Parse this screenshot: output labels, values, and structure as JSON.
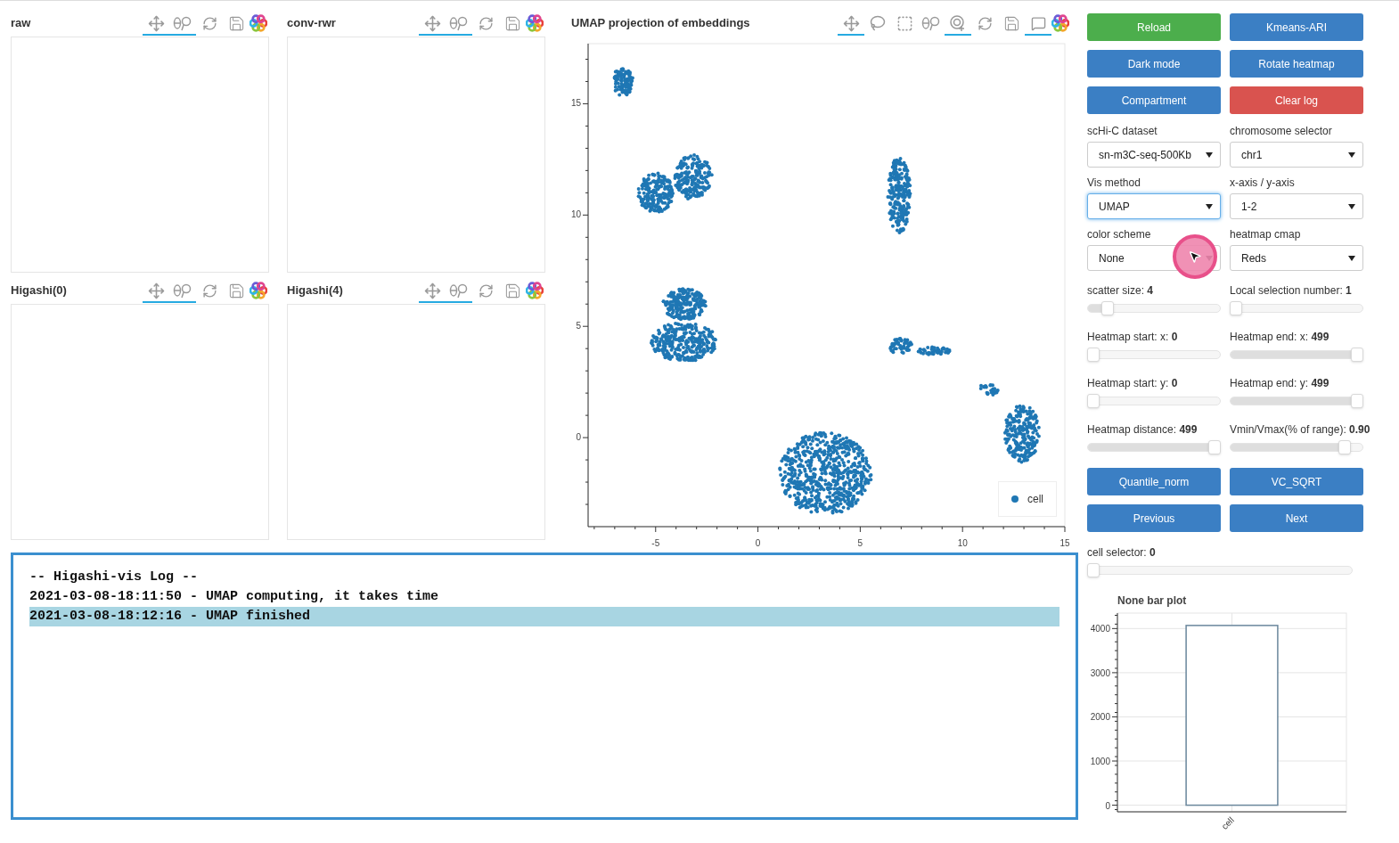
{
  "small_plots": [
    {
      "title": "raw",
      "tools": [
        {
          "kind": "pan",
          "active": true
        },
        {
          "kind": "wheel_zoom",
          "active": true
        },
        {
          "kind": "reset",
          "active": false
        },
        {
          "kind": "save",
          "active": false
        },
        {
          "kind": "logo"
        }
      ]
    },
    {
      "title": "conv-rwr",
      "tools": [
        {
          "kind": "pan",
          "active": true
        },
        {
          "kind": "wheel_zoom",
          "active": true
        },
        {
          "kind": "reset",
          "active": false
        },
        {
          "kind": "save",
          "active": false
        },
        {
          "kind": "logo"
        }
      ]
    },
    {
      "title": "Higashi(0)",
      "tools": [
        {
          "kind": "pan",
          "active": true
        },
        {
          "kind": "wheel_zoom",
          "active": true
        },
        {
          "kind": "reset",
          "active": false
        },
        {
          "kind": "save",
          "active": false
        },
        {
          "kind": "logo"
        }
      ]
    },
    {
      "title": "Higashi(4)",
      "tools": [
        {
          "kind": "pan",
          "active": true
        },
        {
          "kind": "wheel_zoom",
          "active": true
        },
        {
          "kind": "reset",
          "active": false
        },
        {
          "kind": "save",
          "active": false
        },
        {
          "kind": "logo"
        }
      ]
    }
  ],
  "scatter": {
    "title": "UMAP projection of embeddings",
    "tools": [
      {
        "kind": "pan",
        "active": true
      },
      {
        "kind": "lasso",
        "active": false
      },
      {
        "kind": "box_select",
        "active": false
      },
      {
        "kind": "wheel_zoom",
        "active": false
      },
      {
        "kind": "tap",
        "active": true
      },
      {
        "kind": "reset",
        "active": false
      },
      {
        "kind": "save",
        "active": false
      },
      {
        "kind": "hover",
        "active": true
      },
      {
        "kind": "logo"
      }
    ],
    "x_tick_labels": [
      "-5",
      "0",
      "5",
      "10",
      "15"
    ],
    "y_tick_labels": [
      "15",
      "10",
      "5",
      "0"
    ],
    "legend": {
      "label": "cell",
      "color": "#1f77b4"
    }
  },
  "log": {
    "lines": [
      {
        "text": "-- Higashi-vis Log --",
        "selected": false
      },
      {
        "text": "2021-03-08-18:11:50 - UMAP computing, it takes time",
        "selected": false
      },
      {
        "text": "2021-03-08-18:12:16 - UMAP finished",
        "selected": true
      }
    ]
  },
  "buttons": [
    {
      "label": "Reload",
      "color": "#4cae4c"
    },
    {
      "label": "Kmeans-ARI",
      "color": "#3b7fc4"
    },
    {
      "label": "Dark mode",
      "color": "#3b7fc4"
    },
    {
      "label": "Rotate heatmap",
      "color": "#3b7fc4"
    },
    {
      "label": "Compartment",
      "color": "#3b7fc4"
    },
    {
      "label": "Clear log",
      "color": "#d9534f"
    }
  ],
  "selects": [
    {
      "label": "scHi-C dataset",
      "value": "sn-m3C-seq-500Kb",
      "focused": false
    },
    {
      "label": "chromosome selector",
      "value": "chr1",
      "focused": false
    },
    {
      "label": "Vis method",
      "value": "UMAP",
      "focused": true
    },
    {
      "label": "x-axis / y-axis",
      "value": "1-2",
      "focused": false
    },
    {
      "label": "color scheme",
      "value": "None",
      "focused": false
    },
    {
      "label": "heatmap cmap",
      "value": "Reds",
      "focused": false
    }
  ],
  "sliders": [
    {
      "label": "scatter size: ",
      "value": "4",
      "level": 0.12
    },
    {
      "label": "Local selection number: ",
      "value": "1",
      "level": 0
    },
    {
      "label": "Heatmap start: x: ",
      "value": "0",
      "level": 0
    },
    {
      "label": "Heatmap end: x: ",
      "value": "499",
      "level": 1
    },
    {
      "label": "Heatmap start: y: ",
      "value": "0",
      "level": 0
    },
    {
      "label": "Heatmap end: y: ",
      "value": "499",
      "level": 1
    },
    {
      "label": "Heatmap distance: ",
      "value": "499",
      "level": 1
    },
    {
      "label": "Vmin/Vmax(% of range): ",
      "value": "0.90",
      "level": 0.9
    }
  ],
  "buttons_bottom": [
    {
      "label": "Quantile_norm",
      "color": "#3b7fc4"
    },
    {
      "label": "VC_SQRT",
      "color": "#3b7fc4"
    },
    {
      "label": "Previous",
      "color": "#3b7fc4"
    },
    {
      "label": "Next",
      "color": "#3b7fc4"
    }
  ],
  "cell_selector": {
    "label": "cell selector: ",
    "value": "0",
    "level": 0
  },
  "bar_plot": {
    "chart_data": {
      "type": "bar",
      "title": "None bar plot",
      "categories": [
        "cell"
      ],
      "values": [
        4070
      ],
      "ylim": [
        -150,
        4350
      ],
      "yticks": [
        0,
        1000,
        2000,
        3000,
        4000
      ],
      "grid": true
    }
  }
}
